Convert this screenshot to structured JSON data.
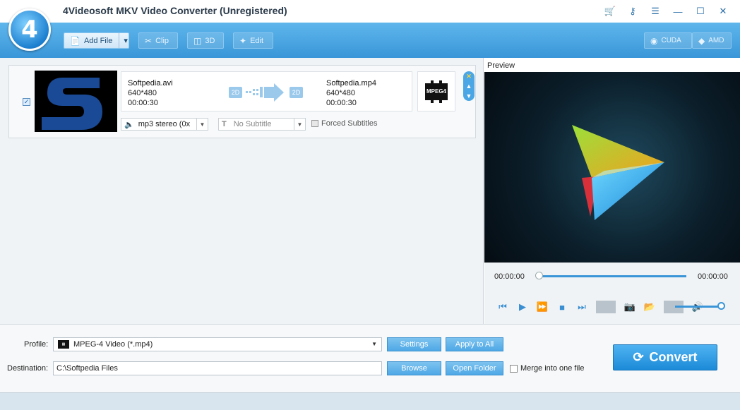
{
  "window": {
    "title": "4Videosoft MKV Video Converter (Unregistered)",
    "logo_glyph": "4",
    "controls": [
      {
        "name": "cart-icon",
        "glyph": "🛒"
      },
      {
        "name": "key-icon",
        "glyph": "⚷"
      },
      {
        "name": "menu-icon",
        "glyph": "☰"
      },
      {
        "name": "minimize-icon",
        "glyph": "—"
      },
      {
        "name": "maximize-icon",
        "glyph": "☐"
      },
      {
        "name": "close-icon",
        "glyph": "✕"
      }
    ]
  },
  "toolbar": {
    "add_file": "Add File",
    "clip": "Clip",
    "threed": "3D",
    "edit": "Edit",
    "cuda": "CUDA",
    "amd": "AMD"
  },
  "file": {
    "checked": true,
    "source": {
      "name": "Softpedia.avi",
      "resolution": "640*480",
      "duration": "00:00:30"
    },
    "output": {
      "name": "Softpedia.mp4",
      "resolution": "640*480",
      "duration": "00:00:30"
    },
    "badge_2d": "2D",
    "format_badge": "MPEG4",
    "audio_track": "mp3 stereo (0x",
    "subtitle": "No Subtitle",
    "forced_subtitles": "Forced Subtitles"
  },
  "preview": {
    "label": "Preview",
    "time_current": "00:00:00",
    "time_total": "00:00:00",
    "seek_progress": 0,
    "volume_level": 1.0
  },
  "bottom": {
    "profile_label": "Profile:",
    "profile_value": "MPEG-4 Video (*.mp4)",
    "settings": "Settings",
    "apply_to_all": "Apply to All",
    "destination_label": "Destination:",
    "destination_value": "C:\\Softpedia Files",
    "browse": "Browse",
    "open_folder": "Open Folder",
    "merge": "Merge into one file",
    "convert": "Convert"
  },
  "colors": {
    "toolbar": "#3a96d8",
    "accent": "#1c8ad8",
    "seek": "#3a95d8"
  }
}
